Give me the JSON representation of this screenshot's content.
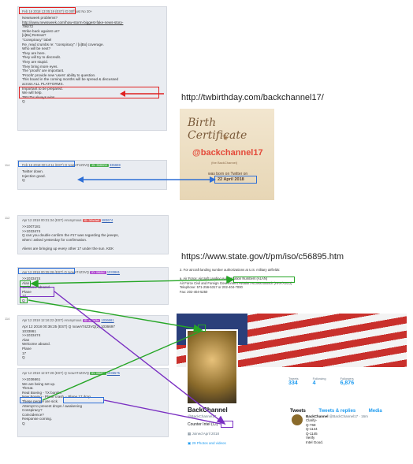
{
  "posts": {
    "p1": {
      "side": "",
      "header": "Feb 16 2018 13:05:19 (EST) ID:00ff just No 30+",
      "lines": [
        "Newsweek problems?",
        "http://www.newsweek.com/how-storm-biggest-fake-news-story-",
        "796/72",
        "Strike back against us?",
        "[x]Bx] Retreat?",
        "\"Conspiracy\" label",
        "Re_read crumbs re: \"conspiracy\" / [x]Bx] coverage.",
        "Who will be next?",
        "They are here.",
        "They will try to discredit.",
        "They are stupid.",
        "They bring more eyes.",
        "The 'proofs' are important.",
        "'Proofs' provide new 'users' ability to question.",
        "This board in the coming months will be spread & discussed",
        "across ALL PLATFORMS.",
        "Important to be prepared.",
        "We will help.",
        "TRUTH always wins.",
        "Q"
      ]
    },
    "p2": {
      "side": "114",
      "header": "Feb 16 2018 00:14:11 (EST) Q !xowAT4Z3VQ",
      "tag": "ID: 3585C8",
      "num": "335669",
      "lines": [
        "Twitter down.",
        "Injection good.",
        "Q"
      ]
    },
    "p3": {
      "side": "112",
      "header": "Apr 12 2018 00:31:34 (EST) Anonymous",
      "tag": "ID: 3f0c0a5",
      "num": "883674",
      "lines": [
        ">>1007181",
        ">>1033474",
        "Q can you double confirm the #17 was regarding the jeeeps,",
        "when i asked yesterday for confirmation.",
        "",
        "Aliens are bringing up every other 17 under the sun. KEK"
      ]
    },
    "p4": {
      "header": "Apr 12 2018 00:35:28 (EST) Q !xowAT4Z3VQ",
      "tag": "ID: 0f684f",
      "num": "1033861",
      "lines": [
        ">>1033474",
        "Alan",
        "Welcome aboard.",
        "Plane",
        "17",
        "Q"
      ]
    },
    "p5": {
      "side": "114",
      "header": "Apr 12 2018 12:16:22 (EST) Anonymous",
      "tag": "ID: a03d3a",
      "num": "1036661",
      "lines": [
        "Apr 12 2018 00:36:25 (EST) Q !xowAT4Z3VQ(2) 1036697",
        "1033861",
        ">>1033474",
        "Alan",
        "Welcome aboard.",
        "Plane",
        "17",
        "Q"
      ]
    },
    "p6": {
      "header": "Apr 12 2018 12:57:28 (EST) Q !xowAT4Z3VQ",
      "tag": "ID: 0f684f",
      "num": "1036575",
      "lines": [
        ">>1036661",
        "We are being set up.",
        "Threat.",
        "Real Boeing - TX bombs",
        "New Boeing - Plane crash = Plane 17 drop.",
        "These people are sick.",
        "Attempt to prevent drops / awakening",
        "Conspiracy?",
        "Coincidence?",
        "Response coming.",
        "Q"
      ]
    }
  },
  "urls": {
    "twbirthday": "http://twbirthday.com/backchannel17/",
    "state": "https://www.state.gov/t/pm/iso/c56895.htm"
  },
  "certificate": {
    "title": "Birth Certificate",
    "handle": "@backchannel17",
    "name": "(the BackChannel)",
    "was_born": "was born on Twitter on",
    "date": "22 April 2018"
  },
  "state_doc": {
    "lines": [
      "2. For aircraft landing number authorizations at U.S. military airfields:",
      "",
      "a. Air Force: Aircraft Landing Authorization Numbers (ALAN)",
      "   Air Force Civil and Foreign Government Aviation Access Branch (HAF/A3OJ)",
      "   Telephone: 571-256-5317 or 202-404-7000",
      "   Fax: 202-404-5250"
    ]
  },
  "profile": {
    "name": "BackChannel",
    "handle": "@BackChannel17",
    "bio": "Counter Intel (CI)",
    "joined": "Joined April 2018",
    "photos": "29 Photos and videos",
    "stats": [
      {
        "label": "Tweets",
        "value": "334"
      },
      {
        "label": "Following",
        "value": "4"
      },
      {
        "label": "Followers",
        "value": "6,876"
      }
    ],
    "tabs": [
      "Tweets",
      "Tweets & replies",
      "Media"
    ],
    "tweet": {
      "author": "BackChannel",
      "meta": "@BackChannel17 · 16m",
      "lines": [
        "Clarify-",
        "Q-768",
        "Q-1144",
        "Q-1145",
        "Verify",
        "Intel Good."
      ]
    }
  },
  "colors": {
    "red": "#e02020",
    "blue": "#2e6fd6",
    "green": "#26a626",
    "purple": "#7a2fc2"
  }
}
